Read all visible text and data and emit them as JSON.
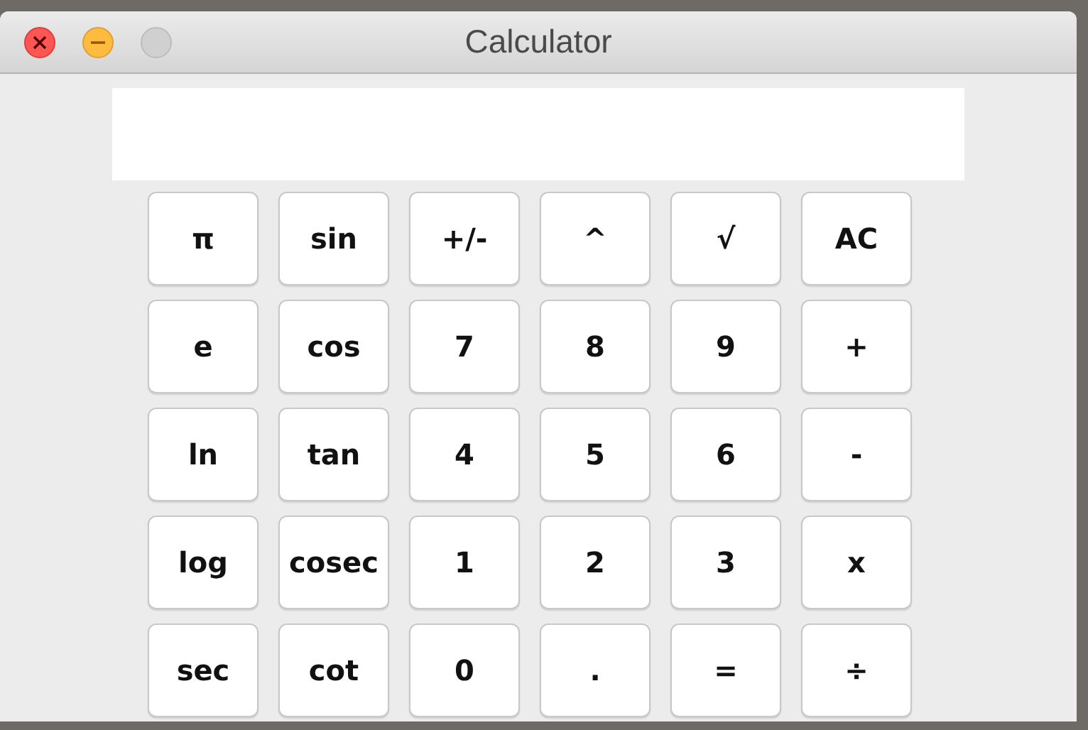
{
  "window": {
    "title": "Calculator"
  },
  "keys": [
    [
      "π",
      "sin",
      "+/-",
      "^",
      "√",
      "AC"
    ],
    [
      "e",
      "cos",
      "7",
      "8",
      "9",
      "+"
    ],
    [
      "ln",
      "tan",
      "4",
      "5",
      "6",
      "-"
    ],
    [
      "log",
      "cosec",
      "1",
      "2",
      "3",
      "x"
    ],
    [
      "sec",
      "cot",
      "0",
      ".",
      "=",
      "÷"
    ]
  ]
}
